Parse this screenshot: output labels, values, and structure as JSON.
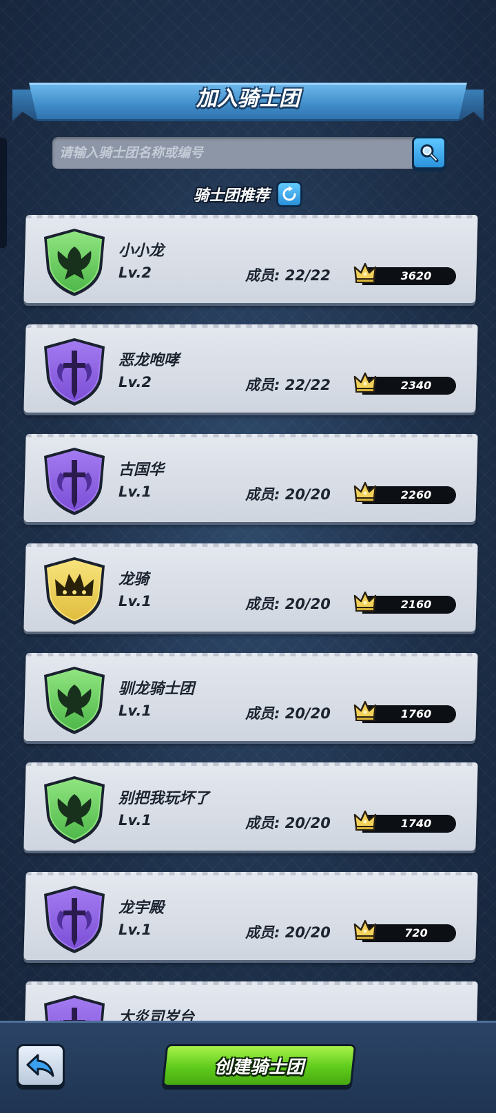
{
  "header": {
    "title": "加入骑士团"
  },
  "search": {
    "placeholder": "请输入骑士团名称或编号",
    "icon": "magnifier-icon"
  },
  "recommend": {
    "label": "骑士团推荐",
    "refresh_icon": "refresh-icon"
  },
  "guilds": [
    {
      "name": "小小龙",
      "level": "Lv.2",
      "members": "成员: 22/22",
      "score": "3620",
      "emblem": "green-dragon"
    },
    {
      "name": "恶龙咆哮",
      "level": "Lv.2",
      "members": "成员: 22/22",
      "score": "2340",
      "emblem": "purple-sword"
    },
    {
      "name": "古国华",
      "level": "Lv.1",
      "members": "成员: 20/20",
      "score": "2260",
      "emblem": "purple-sword"
    },
    {
      "name": "龙骑",
      "level": "Lv.1",
      "members": "成员: 20/20",
      "score": "2160",
      "emblem": "gold-crown"
    },
    {
      "name": "驯龙骑士团",
      "level": "Lv.1",
      "members": "成员: 20/20",
      "score": "1760",
      "emblem": "green-dragon"
    },
    {
      "name": "别把我玩坏了",
      "level": "Lv.1",
      "members": "成员: 20/20",
      "score": "1740",
      "emblem": "green-dragon"
    },
    {
      "name": "龙宇殿",
      "level": "Lv.1",
      "members": "成员: 20/20",
      "score": "720",
      "emblem": "purple-sword"
    },
    {
      "name": "大炎司岁台",
      "level": "",
      "members": "",
      "score": "",
      "emblem": "purple-sword"
    }
  ],
  "footer": {
    "back_icon": "back-arrow-icon",
    "create_label": "创建骑士团"
  },
  "colors": {
    "emblem_green": "#5fcf58",
    "emblem_purple": "#7c4fd6",
    "emblem_gold": "#e6c44a",
    "create_green": "#5fcb1c",
    "accent_blue": "#2b93dc"
  }
}
